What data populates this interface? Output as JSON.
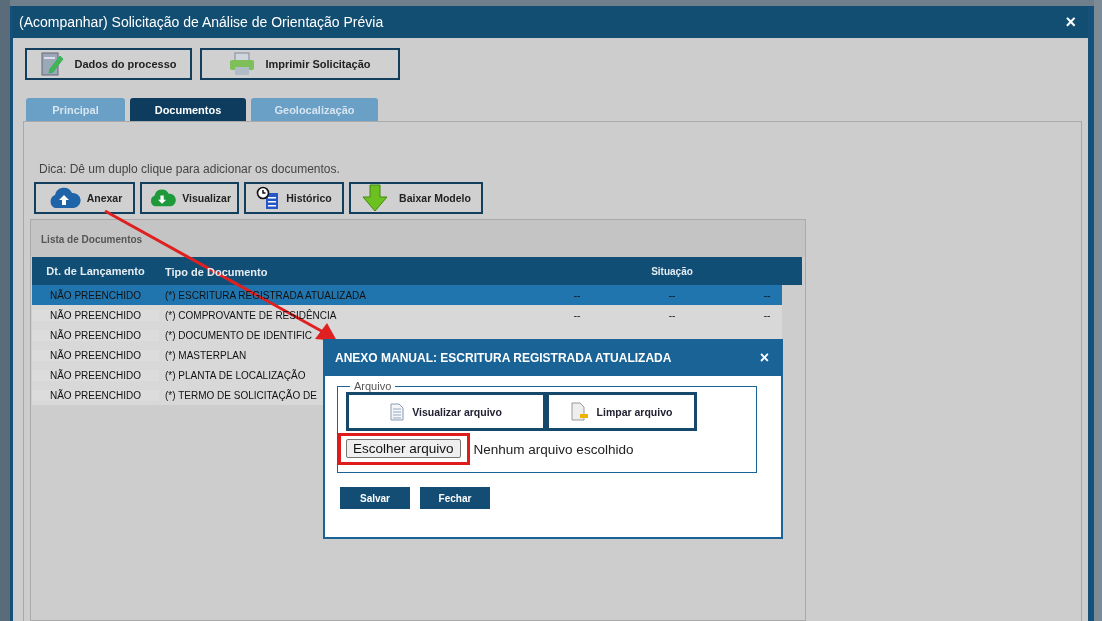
{
  "dialog": {
    "title": "(Acompanhar) Solicitação de Análise de Orientação Prévia",
    "close": "×"
  },
  "top_buttons": [
    {
      "kind": "edit",
      "label": "Dados do processo"
    },
    {
      "kind": "print",
      "label": "Imprimir Solicitação"
    }
  ],
  "tabs": [
    {
      "label": "Principal",
      "selected": false
    },
    {
      "label": "Documentos",
      "selected": true
    },
    {
      "label": "Geolocalização",
      "selected": false
    }
  ],
  "hint": "Dica: Dê um duplo clique para adicionar os documentos.",
  "doc_buttons": [
    {
      "kind": "upload",
      "label": "Anexar"
    },
    {
      "kind": "download",
      "label": "Visualizar"
    },
    {
      "kind": "history",
      "label": "Histórico"
    },
    {
      "kind": "arrow",
      "label": "Baixar Modelo"
    }
  ],
  "list": {
    "title": "Lista de Documentos",
    "columns": [
      "Dt. de Lançamento",
      "Tipo de Documento",
      "",
      "Situação",
      ""
    ],
    "rows": [
      {
        "date": "NÃO PREENCHIDO",
        "type": "(*) ESCRITURA REGISTRADA ATUALIZADA",
        "selected": true,
        "cells": [
          "--",
          "--",
          "--"
        ]
      },
      {
        "date": "NÃO PREENCHIDO",
        "type": "(*) COMPROVANTE DE RESIDÊNCIA",
        "selected": false,
        "cells": [
          "--",
          "--",
          "--"
        ]
      },
      {
        "date": "NÃO PREENCHIDO",
        "type": "(*) DOCUMENTO DE IDENTIFIC",
        "selected": false,
        "cells": []
      },
      {
        "date": "NÃO PREENCHIDO",
        "type": "(*) MASTERPLAN",
        "selected": false,
        "cells": []
      },
      {
        "date": "NÃO PREENCHIDO",
        "type": "(*) PLANTA DE LOCALIZAÇÃO",
        "selected": false,
        "cells": []
      },
      {
        "date": "NÃO PREENCHIDO",
        "type": "(*) TERMO DE SOLICITAÇÃO DE",
        "selected": false,
        "cells": []
      }
    ]
  },
  "modal": {
    "title": "ANEXO MANUAL: ESCRITURA REGISTRADA ATUALIZADA",
    "close": "×",
    "legend": "Arquivo",
    "buttons": [
      {
        "kind": "view",
        "label": "Visualizar arquivo"
      },
      {
        "kind": "clear",
        "label": "Limpar arquivo"
      }
    ],
    "file_button": "Escolher arquivo",
    "file_status": "Nenhum arquivo escolhido",
    "actions": [
      "Salvar",
      "Fechar"
    ]
  }
}
